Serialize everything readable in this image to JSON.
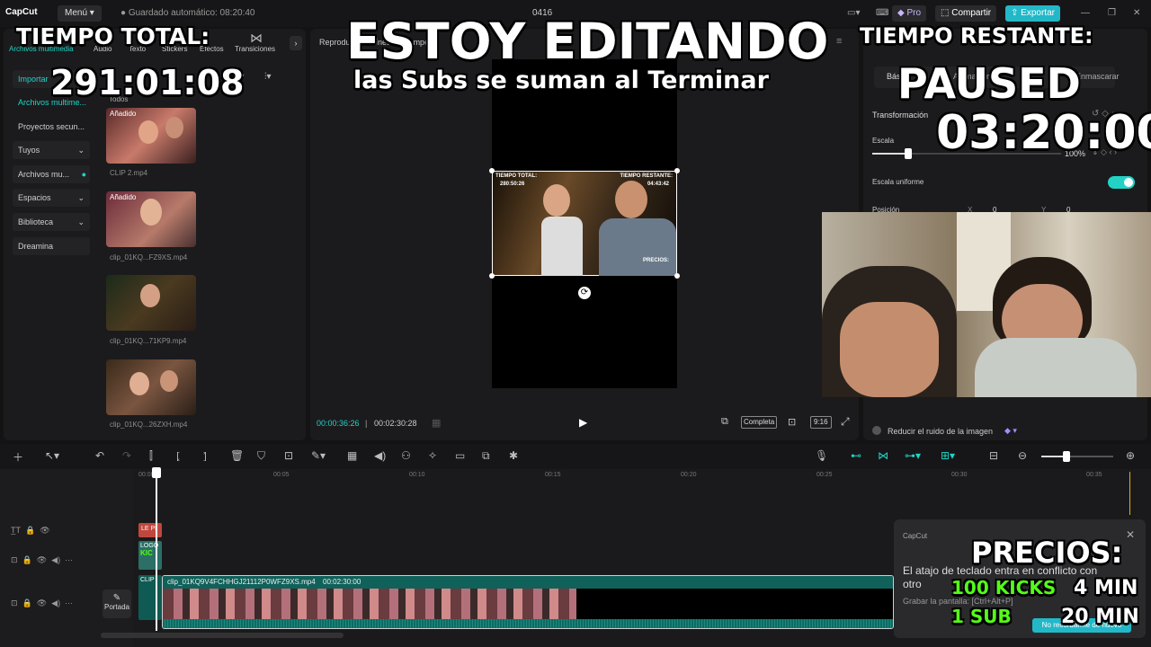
{
  "app": {
    "logo": "CapCut",
    "menu": "Menú",
    "autosave": "Guardado automático: 08:20:40",
    "project": "0416"
  },
  "topbar": {
    "pro": "Pro",
    "share": "Compartir",
    "export": "Exportar"
  },
  "left_tabs": [
    "Archivos multimedia",
    "Audio",
    "Texto",
    "Stickers",
    "Efectos",
    "Transiciones"
  ],
  "left_nav": {
    "import": "Importar",
    "media": "Archivos multime...",
    "projects": "Proyectos secun...",
    "yours": "Tuyos",
    "media2": "Archivos mu...",
    "spaces": "Espacios",
    "library": "Biblioteca",
    "dreamina": "Dreamina"
  },
  "media_header": "Todos",
  "media_items": [
    {
      "tag": "Añadido",
      "name": "CLIP 2.mp4"
    },
    {
      "tag": "Añadido",
      "name": "clip_01KQ...FZ9XS.mp4"
    },
    {
      "tag": "",
      "name": "clip_01KQ...71KP9.mp4"
    },
    {
      "tag": "",
      "name": "clip_01KQ...26ZXH.mp4"
    }
  ],
  "player": {
    "title": "Reproductor - Línea de tiempo",
    "current": "00:00:36:26",
    "total": "00:02:30:28",
    "complete": "Completa",
    "ratio": "9:16",
    "inner_total_label": "TIEMPO TOTAL:",
    "inner_total": "280:50:26",
    "inner_left_label": "TIEMPO RESTANTE:",
    "inner_left": "04:43:42",
    "inner_prices": "PRECIOS:"
  },
  "right": {
    "tab_basic": "Básico",
    "tab_ai": "Animación",
    "tab_mask": "Enmascarar",
    "transform": "Transformación",
    "scale": "Escala",
    "scale_value": "100%",
    "uniform": "Escala uniforme",
    "position": "Posición",
    "pos_x_label": "X",
    "pos_x": "0",
    "pos_y_label": "Y",
    "pos_y": "0",
    "noise": "Reducir el ruido de la imagen"
  },
  "overlay": {
    "total_label": "TIEMPO TOTAL:",
    "total_value": "291:01:08",
    "headline": "ESTOY EDITANDO",
    "subline": "las Subs se suman al Terminar",
    "remain_label": "TIEMPO RESTANTE:",
    "paused": "PAUSED",
    "remain_value": "03:20:00",
    "prices_label": "PRECIOS:",
    "price1_item": "100 KICKS",
    "price1_val": "4 MIN",
    "price2_item": "1 SUB",
    "price2_val": "20 MIN"
  },
  "timeline": {
    "ruler": [
      "00:00",
      "00:05",
      "00:10",
      "00:15",
      "00:20",
      "00:25",
      "00:30",
      "00:35"
    ],
    "main_clip": "clip_01KQ9V4FCHHGJ21112P0WFZ9XS.mp4",
    "main_dur": "00:02:30:00",
    "cover": "Portada",
    "text_clip": "LE PI",
    "logo_clip": "LOGO",
    "kick_clip": "KIC",
    "clip_label": "CLIP"
  },
  "toast": {
    "brand": "CapCut",
    "msg": "El atajo de teclado entra en conflicto con otro",
    "hint": "Grabar la pantalla: [Ctrl+Alt+P]",
    "dismiss": "No recordarme de nuevo"
  },
  "colors": {
    "accent": "#22d3c5",
    "pro": "#8b6cff",
    "text_clip": "#c0473f",
    "logo_clip": "#2b6f66",
    "main_track": "#0f5a52",
    "kick_green": "#53fc18"
  }
}
